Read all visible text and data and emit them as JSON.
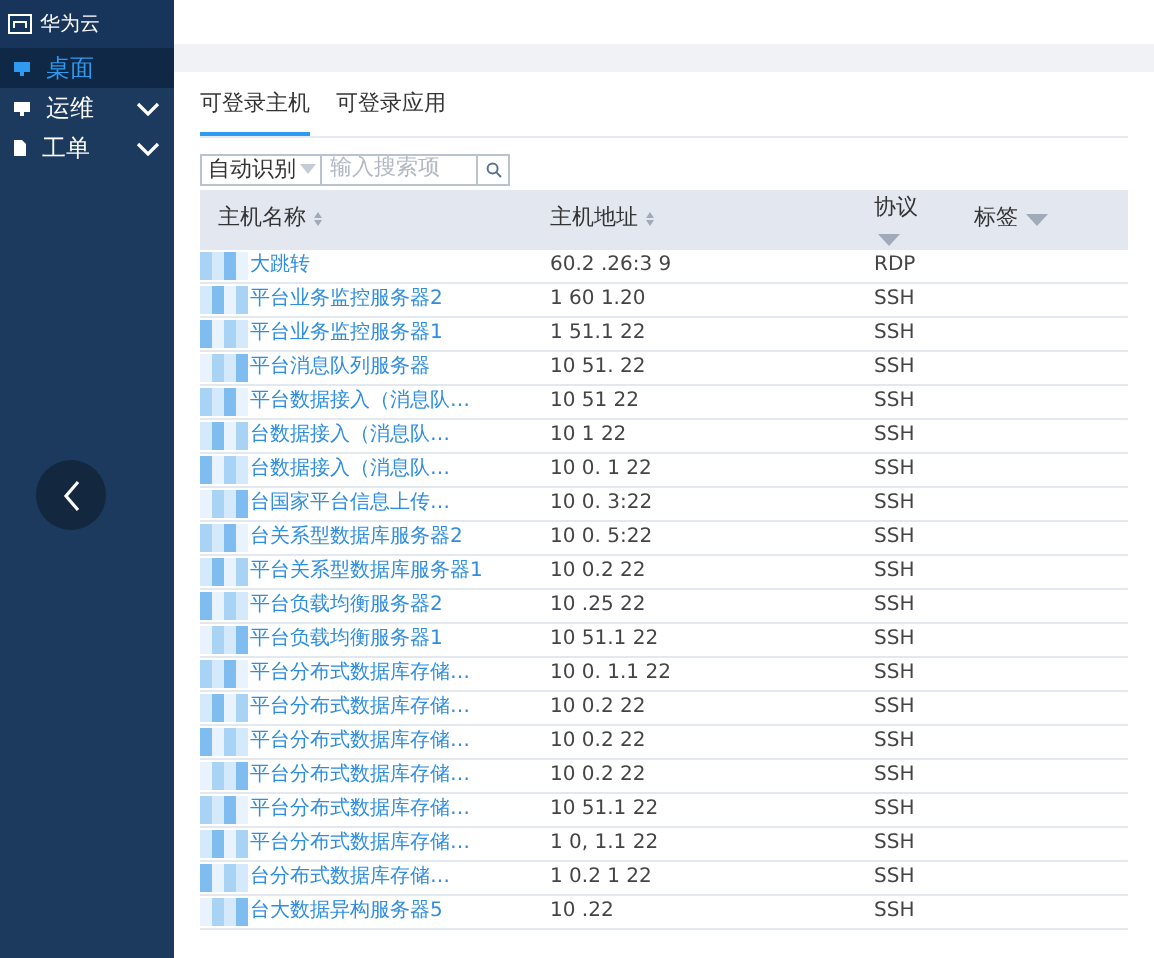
{
  "brand": {
    "title": "华为云"
  },
  "sidebar": {
    "items": [
      {
        "label": "桌面",
        "kind": "link",
        "selected": true
      },
      {
        "label": "运维",
        "kind": "group",
        "selected": false
      },
      {
        "label": "工单",
        "kind": "group",
        "selected": false
      }
    ]
  },
  "tabs": [
    {
      "label": "可登录主机",
      "selected": true
    },
    {
      "label": "可登录应用",
      "selected": false
    }
  ],
  "search": {
    "mode": "自动识别",
    "placeholder": "输入搜索项"
  },
  "table": {
    "columns": [
      "主机名称",
      "主机地址",
      "协议",
      "标签"
    ],
    "rows": [
      [
        "大跳转",
        "60.2 .26:3 9",
        "RDP"
      ],
      [
        "平台业务监控服务器2",
        "1 60 1.20",
        "SSH"
      ],
      [
        "平台业务监控服务器1",
        "1 51.1 22",
        "SSH"
      ],
      [
        "平台消息队列服务器",
        "10 51. 22",
        "SSH"
      ],
      [
        "平台数据接入（消息队…",
        "10 51 22",
        "SSH"
      ],
      [
        "台数据接入（消息队…",
        "10 1 22",
        "SSH"
      ],
      [
        "台数据接入（消息队…",
        "10 0. 1 22",
        "SSH"
      ],
      [
        "台国家平台信息上传…",
        "10 0. 3:22",
        "SSH"
      ],
      [
        "台关系型数据库服务器2",
        "10 0. 5:22",
        "SSH"
      ],
      [
        "平台关系型数据库服务器1",
        "10 0.2 22",
        "SSH"
      ],
      [
        "平台负载均衡服务器2",
        "10 .25 22",
        "SSH"
      ],
      [
        "平台负载均衡服务器1",
        "10 51.1 22",
        "SSH"
      ],
      [
        "平台分布式数据库存储…",
        "10 0. 1.1 22",
        "SSH"
      ],
      [
        "平台分布式数据库存储…",
        "10 0.2 22",
        "SSH"
      ],
      [
        "平台分布式数据库存储…",
        "10 0.2 22",
        "SSH"
      ],
      [
        "平台分布式数据库存储…",
        "10 0.2 22",
        "SSH"
      ],
      [
        "平台分布式数据库存储…",
        "10 51.1 22",
        "SSH"
      ],
      [
        "平台分布式数据库存储…",
        "1 0, 1.1 22",
        "SSH"
      ],
      [
        "台分布式数据库存储…",
        "1 0.2 1 22",
        "SSH"
      ],
      [
        "台大数据异构服务器5",
        "10 .22",
        "SSH"
      ]
    ]
  }
}
